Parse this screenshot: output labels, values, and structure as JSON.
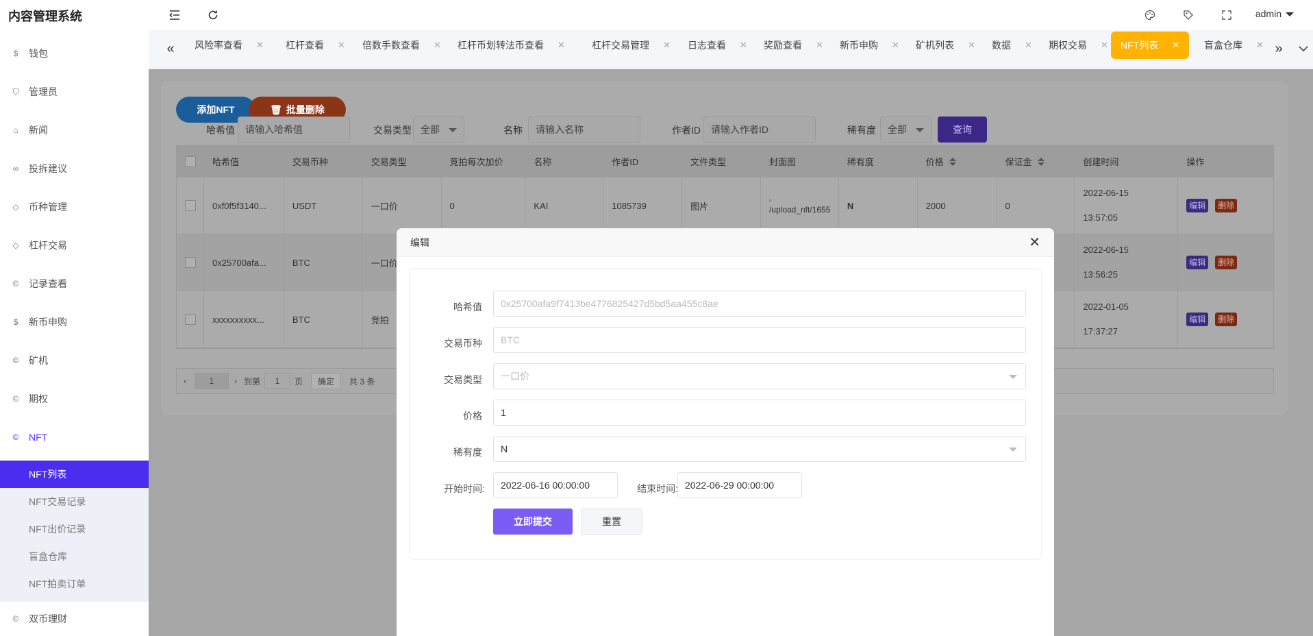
{
  "app": {
    "title": "内容管理系统",
    "user": "admin"
  },
  "sidebar": {
    "items": [
      {
        "label": "钱包",
        "icon": "dollar-circle-icon"
      },
      {
        "label": "管理员",
        "icon": "shield-icon"
      },
      {
        "label": "新闻",
        "icon": "tag-icon"
      },
      {
        "label": "投拆建议",
        "icon": "link-icon"
      },
      {
        "label": "币种管理",
        "icon": "diamond-icon"
      },
      {
        "label": "杠杆交易",
        "icon": "diamond-icon"
      },
      {
        "label": "记录查看",
        "icon": "c-circle-icon"
      },
      {
        "label": "新币申购",
        "icon": "dollar-circle-icon"
      },
      {
        "label": "矿机",
        "icon": "c-circle-icon"
      },
      {
        "label": "期权",
        "icon": "c-circle-icon"
      },
      {
        "label": "NFT",
        "icon": "c-circle-icon"
      }
    ],
    "sub_items": [
      "NFT列表",
      "NFT交易记录",
      "NFT出价记录",
      "盲盒仓库",
      "NFT拍卖订单"
    ],
    "bottom_item": {
      "label": "双币理财",
      "icon": "c-circle-icon"
    }
  },
  "tabs": [
    "风险率查看",
    "杠杆查看",
    "倍数手数查看",
    "杠杆币划转法币查看",
    "杠杆交易管理",
    "日志查看",
    "奖励查看",
    "新币申购",
    "矿机列表",
    "数据",
    "期权交易",
    "NFT列表",
    "盲盒仓库"
  ],
  "toolbar": {
    "add_label": "添加NFT",
    "batch_delete_label": "批量删除"
  },
  "filters": {
    "hash_label": "哈希值",
    "hash_placeholder": "请输入哈希值",
    "trade_type_label": "交易类型",
    "trade_type_value": "全部",
    "name_label": "名称",
    "name_placeholder": "请输入名称",
    "author_label": "作者ID",
    "author_placeholder": "请输入作者ID",
    "rarity_label": "稀有度",
    "rarity_value": "全部",
    "query_label": "查询"
  },
  "table": {
    "columns": [
      "哈希值",
      "交易币种",
      "交易类型",
      "竞拍每次加价",
      "名称",
      "作者ID",
      "文件类型",
      "封面图",
      "稀有度",
      "价格",
      "保证金",
      "创建时间",
      "操作"
    ],
    "rows": [
      {
        "hash": "0xf0f5f3140...",
        "coin": "USDT",
        "type": "一口价",
        "increment": "0",
        "name": "KAI",
        "author": "1085739",
        "file": "图片",
        "cover": "/upload_nft/1655",
        "rarity": "N",
        "price": "2000",
        "deposit": "0",
        "date": "2022-06-15",
        "time": "13:57:05"
      },
      {
        "hash": "0x25700afa...",
        "coin": "BTC",
        "type": "一口价",
        "increment": "",
        "name": "",
        "author": "",
        "file": "",
        "cover": "",
        "rarity": "",
        "price": "",
        "deposit": "",
        "date": "2022-06-15",
        "time": "13:56:25"
      },
      {
        "hash": "xxxxxxxxxx...",
        "coin": "BTC",
        "type": "竞拍",
        "increment": "",
        "name": "",
        "author": "",
        "file": "",
        "cover": "",
        "rarity": "",
        "price": "",
        "deposit": "",
        "date": "2022-01-05",
        "time": "17:37:27"
      }
    ],
    "edit_label": "编辑",
    "delete_label": "删除"
  },
  "pager": {
    "page": "1",
    "goto_label": "到第",
    "goto_value": "1",
    "page_unit": "页",
    "confirm": "确定",
    "total": "共 3 条"
  },
  "modal": {
    "title": "编辑",
    "hash_label": "哈希值",
    "hash_value": "0x25700afa9f7413be4776825427d5bd5aa455c8ae",
    "coin_label": "交易币种",
    "coin_value": "BTC",
    "type_label": "交易类型",
    "type_value": "一口价",
    "price_label": "价格",
    "price_value": "1",
    "rarity_label": "稀有度",
    "rarity_value": "N",
    "start_label": "开始时间:",
    "start_value": "2022-06-16 00:00:00",
    "end_label": "结束时间:",
    "end_value": "2022-06-29 00:00:00",
    "submit_label": "立即提交",
    "reset_label": "重置"
  },
  "colors": {
    "accent": "#4b2df0",
    "active_tab": "#ffb300",
    "add_button": "#1e88e5",
    "delete_button": "#e64a19"
  }
}
